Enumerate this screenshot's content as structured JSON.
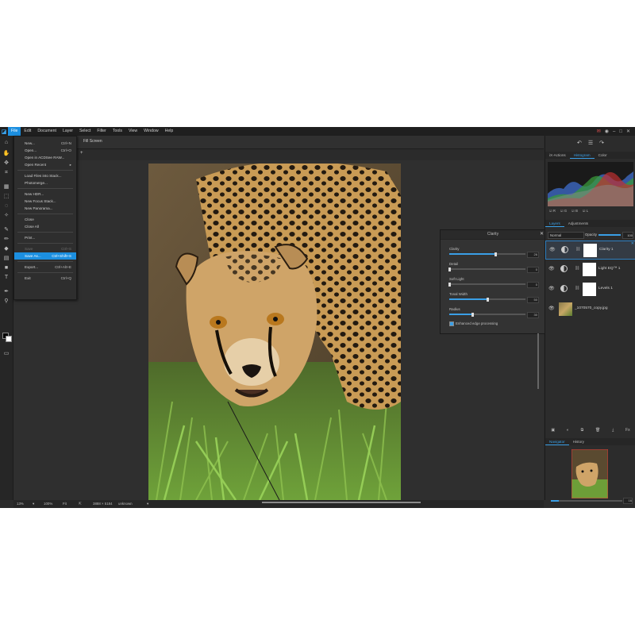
{
  "menubar": {
    "items": [
      "File",
      "Edit",
      "Document",
      "Layer",
      "Select",
      "Filter",
      "Tools",
      "View",
      "Window",
      "Help"
    ],
    "active_index": 0
  },
  "optbar": {
    "fill_screen": "Fill Screen"
  },
  "file_menu": [
    {
      "label": "New...",
      "shortcut": "Ctrl+N"
    },
    {
      "label": "Open...",
      "shortcut": "Ctrl+O"
    },
    {
      "label": "Open in ACDSee RAW...",
      "shortcut": ""
    },
    {
      "label": "Open Recent",
      "shortcut": "▸"
    },
    {
      "label": "Load Files into Stack...",
      "shortcut": ""
    },
    {
      "label": "Photomerge...",
      "shortcut": ""
    },
    {
      "label": "New HDR...",
      "shortcut": ""
    },
    {
      "label": "New Focus Stack...",
      "shortcut": ""
    },
    {
      "label": "New Panorama...",
      "shortcut": ""
    },
    {
      "label": "Close",
      "shortcut": ""
    },
    {
      "label": "Close All",
      "shortcut": ""
    },
    {
      "label": "Print...",
      "shortcut": ""
    },
    {
      "label": "Save",
      "shortcut": "Ctrl+S"
    },
    {
      "label": "Save As...",
      "shortcut": "Ctrl+Shift+S"
    },
    {
      "label": "Export...",
      "shortcut": "Ctrl+Alt+E"
    },
    {
      "label": "Exit",
      "shortcut": "Ctrl+Q"
    }
  ],
  "clarity": {
    "title": "Clarity",
    "sliders": [
      {
        "label": "Clarity",
        "value": "26",
        "fraction": 0.6
      },
      {
        "label": "Detail",
        "value": "0",
        "fraction": 0.0
      },
      {
        "label": "Soft Light",
        "value": "0",
        "fraction": 0.0
      },
      {
        "label": "Tonal Width",
        "value": "50",
        "fraction": 0.5
      },
      {
        "label": "Radius",
        "value": "30",
        "fraction": 0.3
      }
    ],
    "checkbox": "Enhanced edge processing"
  },
  "right_panel": {
    "top_tabs": [
      "iX-Actions",
      "Histogram",
      "Color"
    ],
    "top_active": 1,
    "channels": [
      "R",
      "G",
      "B",
      "L"
    ],
    "layer_tabs": [
      "Layers",
      "Adjustments"
    ],
    "layer_active": 0,
    "blend_mode": "Normal",
    "opacity_label": "Opacity",
    "opacity_value": "100",
    "layers": [
      {
        "name": "Clarity 1",
        "type": "adjustment"
      },
      {
        "name": "Light EQ™ 1",
        "type": "adjustment"
      },
      {
        "name": "Levels 1",
        "type": "adjustment"
      },
      {
        "name": "_1070570_copy.jpg",
        "type": "image"
      }
    ],
    "bottom_tabs": [
      "Navigator",
      "History"
    ],
    "bottom_active": 0,
    "navigator_value": "16"
  },
  "status": {
    "zoom": "13%",
    "zoom_100": "100%",
    "fit": "Fit",
    "dimensions": "3888 × 5184",
    "unit": "unknown"
  },
  "colors": {
    "accent": "#1c8fe0"
  }
}
